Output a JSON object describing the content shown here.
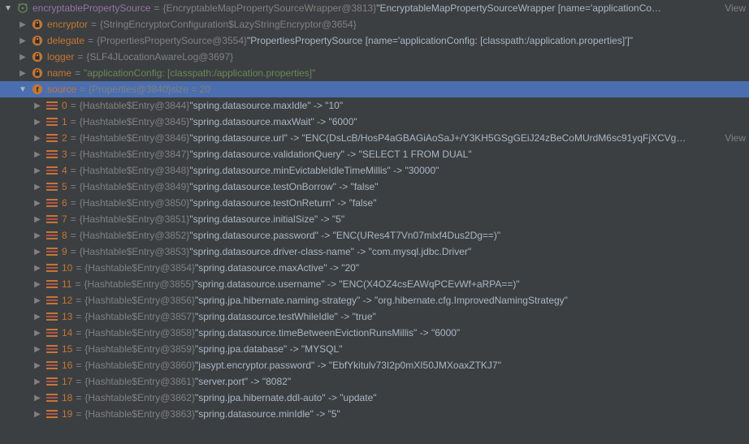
{
  "viewLabel": "View",
  "root": {
    "name": "encryptablePropertySource",
    "type": "{EncryptableMapPropertySourceWrapper@3813}",
    "value": "\"EncryptableMapPropertySourceWrapper [name='applicationCo…"
  },
  "fields": [
    {
      "name": "encryptor",
      "type": "{StringEncryptorConfiguration$LazyStringEncryptor@3654}",
      "value": ""
    },
    {
      "name": "delegate",
      "type": "{PropertiesPropertySource@3554}",
      "value": "\"PropertiesPropertySource [name='applicationConfig: [classpath:/application.properties]']\""
    },
    {
      "name": "logger",
      "type": "{SLF4JLocationAwareLog@3697}",
      "value": ""
    },
    {
      "name": "name",
      "type": "",
      "value": "\"applicationConfig: [classpath:/application.properties]\"",
      "stringOnly": true
    }
  ],
  "source": {
    "name": "source",
    "type": "{Properties@3840}",
    "size": "size = 20"
  },
  "entries": [
    {
      "idx": "0",
      "type": "{Hashtable$Entry@3844}",
      "kv": "\"spring.datasource.maxIdle\" -> \"10\""
    },
    {
      "idx": "1",
      "type": "{Hashtable$Entry@3845}",
      "kv": "\"spring.datasource.maxWait\" -> \"6000\""
    },
    {
      "idx": "2",
      "type": "{Hashtable$Entry@3846}",
      "kv": "\"spring.datasource.url\" -> \"ENC(DsLcB/HosP4aGBAGiAoSaJ+/Y3KH5GSgGEiJ24zBeCoMUrdM6sc91yqFjXCVg…",
      "hasView": true
    },
    {
      "idx": "3",
      "type": "{Hashtable$Entry@3847}",
      "kv": "\"spring.datasource.validationQuery\" -> \"SELECT 1 FROM DUAL\""
    },
    {
      "idx": "4",
      "type": "{Hashtable$Entry@3848}",
      "kv": "\"spring.datasource.minEvictableIdleTimeMillis\" -> \"30000\""
    },
    {
      "idx": "5",
      "type": "{Hashtable$Entry@3849}",
      "kv": "\"spring.datasource.testOnBorrow\" -> \"false\""
    },
    {
      "idx": "6",
      "type": "{Hashtable$Entry@3850}",
      "kv": "\"spring.datasource.testOnReturn\" -> \"false\""
    },
    {
      "idx": "7",
      "type": "{Hashtable$Entry@3851}",
      "kv": "\"spring.datasource.initialSize\" -> \"5\""
    },
    {
      "idx": "8",
      "type": "{Hashtable$Entry@3852}",
      "kv": "\"spring.datasource.password\" -> \"ENC(URes4T7Vn07mlxf4Dus2Dg==)\""
    },
    {
      "idx": "9",
      "type": "{Hashtable$Entry@3853}",
      "kv": "\"spring.datasource.driver-class-name\" -> \"com.mysql.jdbc.Driver\""
    },
    {
      "idx": "10",
      "type": "{Hashtable$Entry@3854}",
      "kv": "\"spring.datasource.maxActive\" -> \"20\""
    },
    {
      "idx": "11",
      "type": "{Hashtable$Entry@3855}",
      "kv": "\"spring.datasource.username\" -> \"ENC(X4OZ4csEAWqPCEvWf+aRPA==)\""
    },
    {
      "idx": "12",
      "type": "{Hashtable$Entry@3856}",
      "kv": "\"spring.jpa.hibernate.naming-strategy\" -> \"org.hibernate.cfg.ImprovedNamingStrategy\""
    },
    {
      "idx": "13",
      "type": "{Hashtable$Entry@3857}",
      "kv": "\"spring.datasource.testWhileIdle\" -> \"true\""
    },
    {
      "idx": "14",
      "type": "{Hashtable$Entry@3858}",
      "kv": "\"spring.datasource.timeBetweenEvictionRunsMillis\" -> \"6000\""
    },
    {
      "idx": "15",
      "type": "{Hashtable$Entry@3859}",
      "kv": "\"spring.jpa.database\" -> \"MYSQL\""
    },
    {
      "idx": "16",
      "type": "{Hashtable$Entry@3860}",
      "kv": "\"jasypt.encryptor.password\" -> \"EbfYkitulv73I2p0mXI50JMXoaxZTKJ7\""
    },
    {
      "idx": "17",
      "type": "{Hashtable$Entry@3861}",
      "kv": "\"server.port\" -> \"8082\""
    },
    {
      "idx": "18",
      "type": "{Hashtable$Entry@3862}",
      "kv": "\"spring.jpa.hibernate.ddl-auto\" -> \"update\""
    },
    {
      "idx": "19",
      "type": "{Hashtable$Entry@3863}",
      "kv": "\"spring.datasource.minIdle\" -> \"5\""
    }
  ]
}
